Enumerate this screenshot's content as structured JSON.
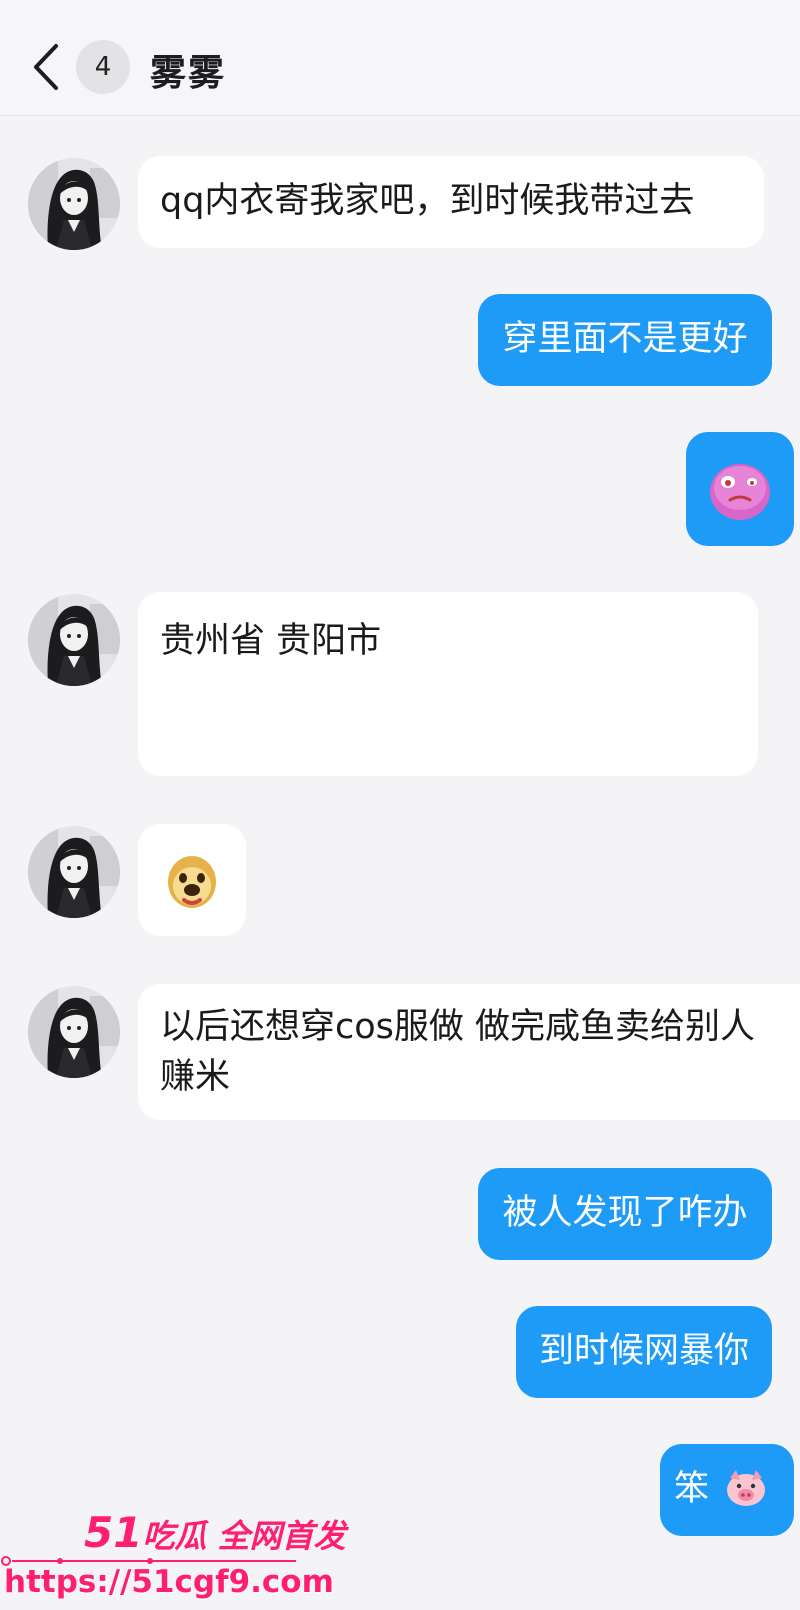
{
  "header": {
    "unread_count": "4",
    "contact_name": "雾雾"
  },
  "messages": [
    {
      "sender": "contact",
      "type": "text",
      "text": "qq内衣寄我家吧，到时候我带过去"
    },
    {
      "sender": "me",
      "type": "text",
      "text": "穿里面不是更好"
    },
    {
      "sender": "me",
      "type": "emoji",
      "emoji": "pink-blob-sticker"
    },
    {
      "sender": "contact",
      "type": "text",
      "text": "贵州省 贵阳市"
    },
    {
      "sender": "contact",
      "type": "emoji",
      "emoji": "dog-face-sticker"
    },
    {
      "sender": "contact",
      "type": "text",
      "text": "以后还想穿cos服做 做完咸鱼卖给别人赚米"
    },
    {
      "sender": "me",
      "type": "text",
      "text": "被人发现了咋办"
    },
    {
      "sender": "me",
      "type": "text",
      "text": "到时候网暴你"
    },
    {
      "sender": "me",
      "type": "text",
      "text": "笨",
      "emoji": "pig-face-icon"
    }
  ],
  "watermark": {
    "brand_number": "51",
    "brand_text": "吃瓜 全网首发",
    "url": "https://51cgf9.com"
  },
  "colors": {
    "outgoing_bubble": "#1d9bf6",
    "incoming_bubble": "#ffffff",
    "watermark": "#ff1f72"
  }
}
